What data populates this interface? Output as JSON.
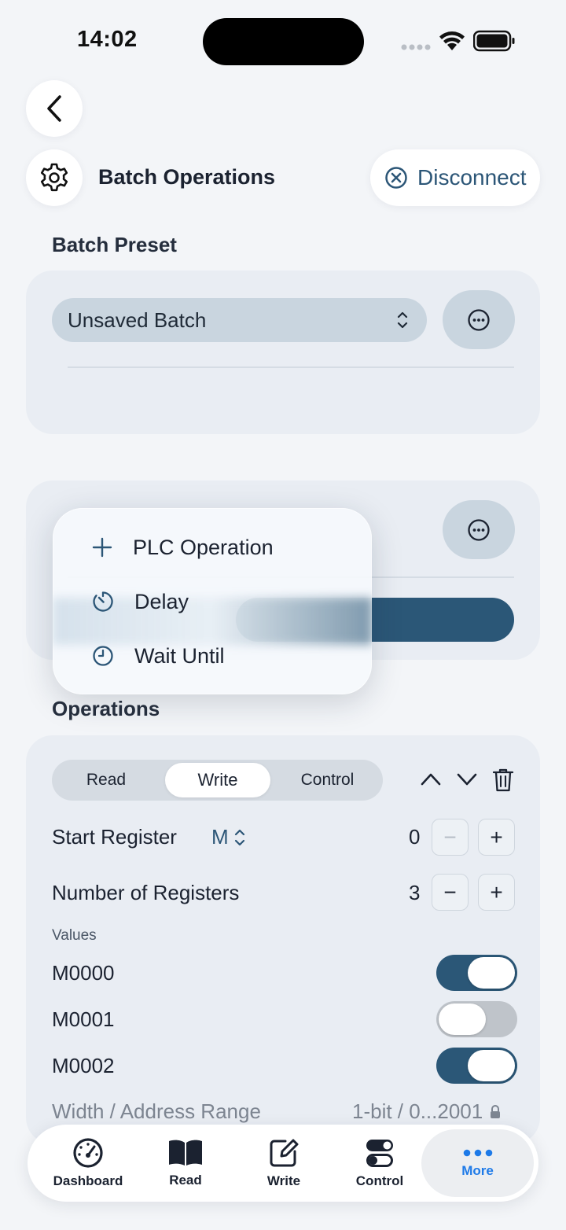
{
  "status_bar": {
    "time": "14:02"
  },
  "header": {
    "title": "Batch Operations",
    "disconnect_label": "Disconnect"
  },
  "batch_preset": {
    "label": "Batch Preset",
    "selected": "Unsaved Batch"
  },
  "add_menu": {
    "items": [
      {
        "label": "PLC Operation",
        "icon": "plus-icon"
      },
      {
        "label": "Delay",
        "icon": "timer-icon"
      },
      {
        "label": "Wait Until",
        "icon": "clock-icon"
      }
    ]
  },
  "operations": {
    "label": "Operations",
    "segments": [
      "Read",
      "Write",
      "Control"
    ],
    "active_segment": "Write",
    "start_register": {
      "label": "Start Register",
      "type": "M",
      "value": "0"
    },
    "num_registers": {
      "label": "Number of Registers",
      "value": "3"
    },
    "values_label": "Values",
    "values": [
      {
        "name": "M0000",
        "on": true
      },
      {
        "name": "M0001",
        "on": false
      },
      {
        "name": "M0002",
        "on": true
      }
    ],
    "range": {
      "label": "Width / Address Range",
      "value": "1-bit / 0...2001"
    }
  },
  "tabbar": {
    "items": [
      {
        "label": "Dashboard",
        "icon": "gauge-icon"
      },
      {
        "label": "Read",
        "icon": "book-icon"
      },
      {
        "label": "Write",
        "icon": "pencil-square-icon"
      },
      {
        "label": "Control",
        "icon": "toggles-icon"
      },
      {
        "label": "More",
        "icon": "ellipsis-icon"
      }
    ],
    "active": "More"
  },
  "colors": {
    "accent": "#2b5777",
    "tab_active": "#1e7ae8",
    "background": "#f3f5f8",
    "card": "#e9edf3"
  }
}
